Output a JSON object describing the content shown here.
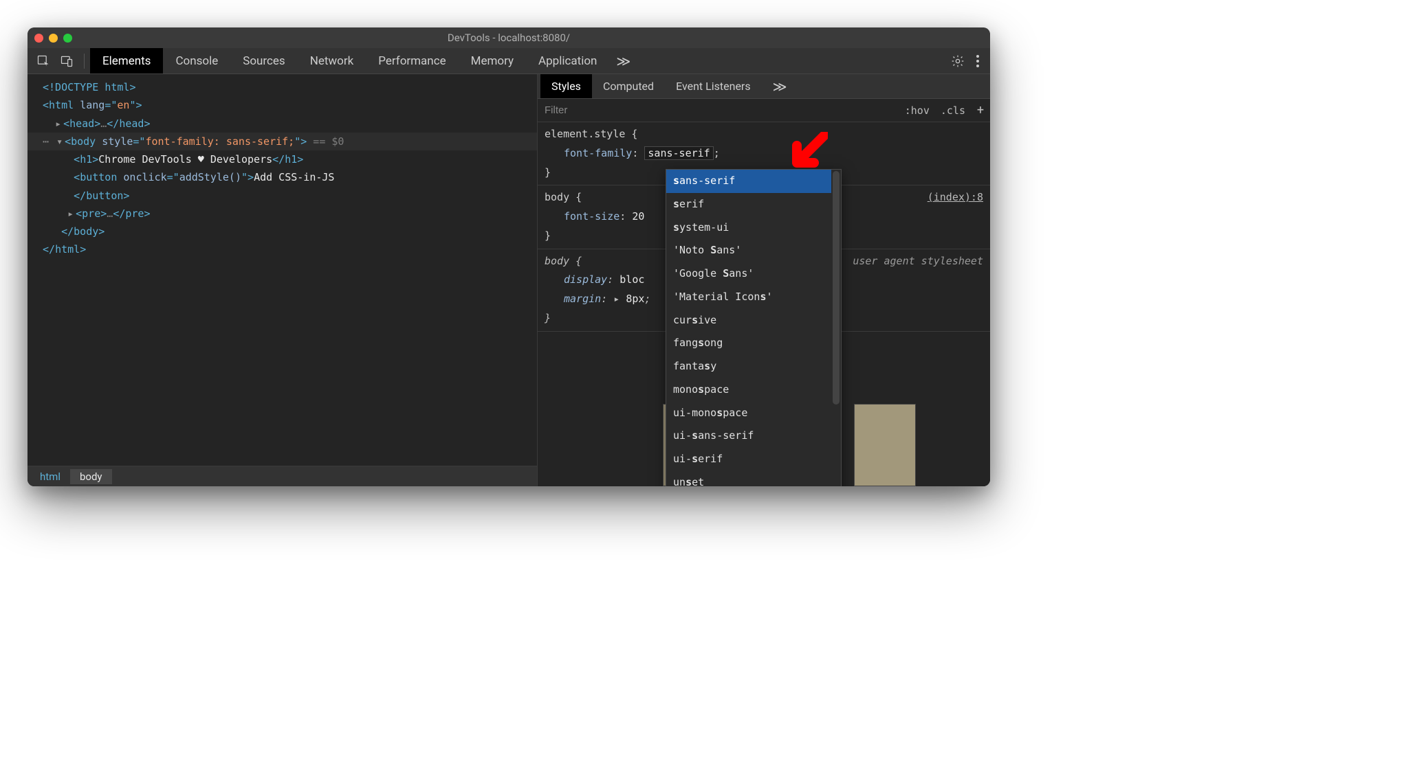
{
  "window": {
    "title": "DevTools - localhost:8080/"
  },
  "main_tabs": {
    "items": [
      "Elements",
      "Console",
      "Sources",
      "Network",
      "Performance",
      "Memory",
      "Application"
    ],
    "active_index": 0,
    "overflow_glyph": "≫"
  },
  "dom": {
    "doctype_open": "<!DOCTYPE ",
    "doctype_text": "html",
    "doctype_close": ">",
    "html_open_tag": "html",
    "html_lang_attr": "lang",
    "html_lang_val": "en",
    "head_tag": "head",
    "ellipsis": "…",
    "body_tag": "body",
    "body_style_attr": "style",
    "body_style_val": "font-family: sans-serif;",
    "selected_suffix": " == $0",
    "h1_tag": "h1",
    "h1_text_pre": "Chrome DevTools ",
    "h1_heart": "♥",
    "h1_text_post": " Developers",
    "button_tag": "button",
    "button_onclick_attr": "onclick",
    "button_onclick_val": "addStyle()",
    "button_text": "Add CSS-in-JS",
    "pre_tag": "pre"
  },
  "breadcrumb": {
    "items": [
      "html",
      "body"
    ],
    "active_index": 1
  },
  "sub_tabs": {
    "items": [
      "Styles",
      "Computed",
      "Event Listeners"
    ],
    "active_index": 0,
    "overflow_glyph": "≫"
  },
  "filter": {
    "placeholder": "Filter",
    "hov_label": ":hov",
    "cls_label": ".cls",
    "plus_glyph": "+"
  },
  "styles_rules": {
    "r0": {
      "selector": "element.style {",
      "prop_name": "font-family",
      "prop_value": "sans-serif",
      "close": "}"
    },
    "r1": {
      "selector": "body {",
      "source": "(index):8",
      "prop_name": "font-size",
      "prop_value": "20",
      "close": "}"
    },
    "r2": {
      "selector": "body {",
      "ua_label": "user agent stylesheet",
      "p1_name": "display",
      "p1_value": "bloc",
      "p2_name": "margin",
      "p2_value": "8px",
      "close": "}"
    }
  },
  "autocomplete": {
    "items": [
      "sans-serif",
      "serif",
      "system-ui",
      "'Noto Sans'",
      "'Google Sans'",
      "'Material Icons'",
      "cursive",
      "fangsong",
      "fantasy",
      "monospace",
      "ui-monospace",
      "ui-sans-serif",
      "ui-serif",
      "unset"
    ],
    "selected_index": 0
  }
}
